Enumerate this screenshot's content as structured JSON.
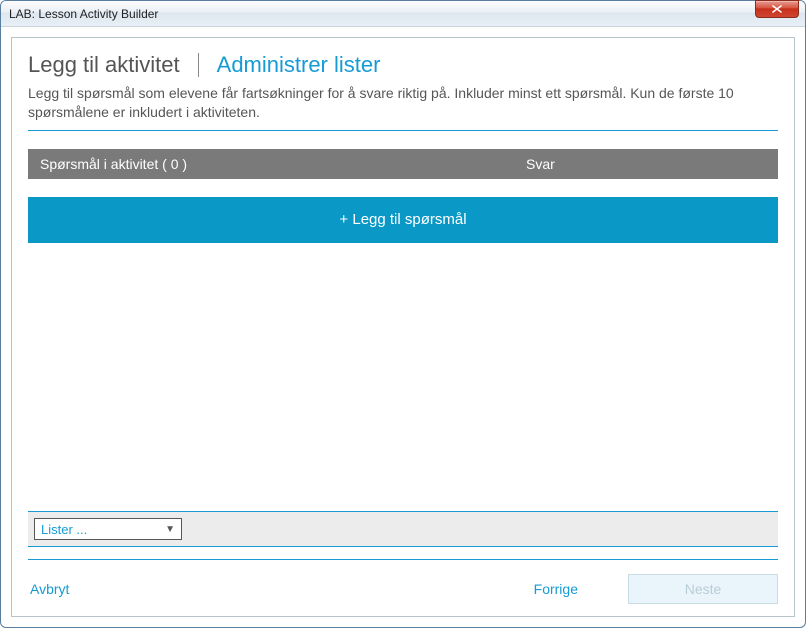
{
  "window": {
    "title": "LAB: Lesson Activity Builder"
  },
  "tabs": {
    "add_activity": "Legg til aktivitet",
    "manage_lists": "Administrer lister"
  },
  "description": "Legg til spørsmål som elevene får fartsøkninger for å svare riktig på. Inkluder minst ett spørsmål. Kun de første 10 spørsmålene er inkludert i aktiviteten.",
  "table": {
    "header_questions": "Spørsmål i aktivitet ( 0 )",
    "header_answers": "Svar"
  },
  "add_question_label": "+ Legg til spørsmål",
  "dropdown": {
    "selected": "Lister ..."
  },
  "footer": {
    "cancel": "Avbryt",
    "previous": "Forrige",
    "next": "Neste"
  }
}
